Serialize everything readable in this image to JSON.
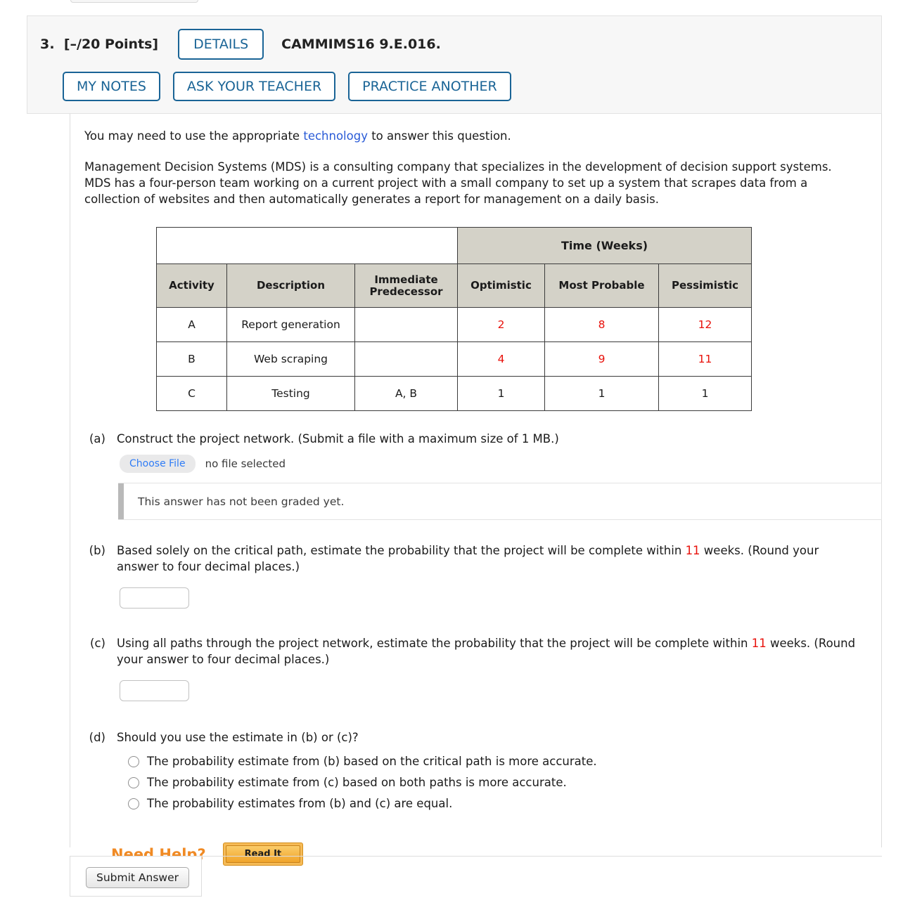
{
  "header": {
    "question_number": "3.",
    "points": "[–/20 Points]",
    "details_label": "DETAILS",
    "exercise_code": "CAMMIMS16 9.E.016.",
    "my_notes_label": "MY NOTES",
    "ask_teacher_label": "ASK YOUR TEACHER",
    "practice_another_label": "PRACTICE ANOTHER"
  },
  "intro": {
    "tech_prefix": "You may need to use the appropriate ",
    "tech_link": "technology",
    "tech_suffix": " to answer this question.",
    "body": "Management Decision Systems (MDS) is a consulting company that specializes in the development of decision support systems. MDS has a four-person team working on a current project with a small company to set up a system that scrapes data from a collection of websites and then automatically generates a report for management on a daily basis."
  },
  "table": {
    "group_header": "Time (Weeks)",
    "columns": [
      "Activity",
      "Description",
      "Immediate Predecessor",
      "Optimistic",
      "Most Probable",
      "Pessimistic"
    ],
    "columns_wrapped": {
      "predecessor_line1": "Immediate",
      "predecessor_line2": "Predecessor"
    },
    "rows": [
      {
        "activity": "A",
        "description": "Report generation",
        "predecessor": "",
        "optimistic": "2",
        "most_probable": "8",
        "pessimistic": "12",
        "highlight": true
      },
      {
        "activity": "B",
        "description": "Web scraping",
        "predecessor": "",
        "optimistic": "4",
        "most_probable": "9",
        "pessimistic": "11",
        "highlight": true
      },
      {
        "activity": "C",
        "description": "Testing",
        "predecessor": "A, B",
        "optimistic": "1",
        "most_probable": "1",
        "pessimistic": "1",
        "highlight": false
      }
    ]
  },
  "parts": {
    "a": {
      "label": "(a)",
      "text": "Construct the project network. (Submit a file with a maximum size of 1 MB.)",
      "choose_file_label": "Choose File",
      "no_file_text": "no file selected",
      "ungraded_text": "This answer has not been graded yet."
    },
    "b": {
      "label": "(b)",
      "text_pre": "Based solely on the critical path, estimate the probability that the project will be complete within ",
      "weeks_value": "11",
      "text_post": " weeks. (Round your answer to four decimal places.)",
      "input_value": ""
    },
    "c": {
      "label": "(c)",
      "text_pre": "Using all paths through the project network, estimate the probability that the project will be complete within ",
      "weeks_value": "11",
      "text_post": " weeks. (Round your answer to four decimal places.)",
      "input_value": ""
    },
    "d": {
      "label": "(d)",
      "text": "Should you use the estimate in (b) or (c)?",
      "options": [
        "The probability estimate from (b) based on the critical path is more accurate.",
        "The probability estimate from (c) based on both paths is more accurate.",
        "The probability estimates from (b) and (c) are equal."
      ]
    }
  },
  "help": {
    "need_help_label": "Need Help?",
    "read_it_label": "Read It"
  },
  "footer": {
    "submit_label": "Submit Answer"
  },
  "colors": {
    "link_blue": "#2a5bd7",
    "button_blue": "#1a6496",
    "highlight_red": "#e8110b",
    "table_header": "#d4d2c8",
    "need_help_orange": "#f08a24"
  }
}
